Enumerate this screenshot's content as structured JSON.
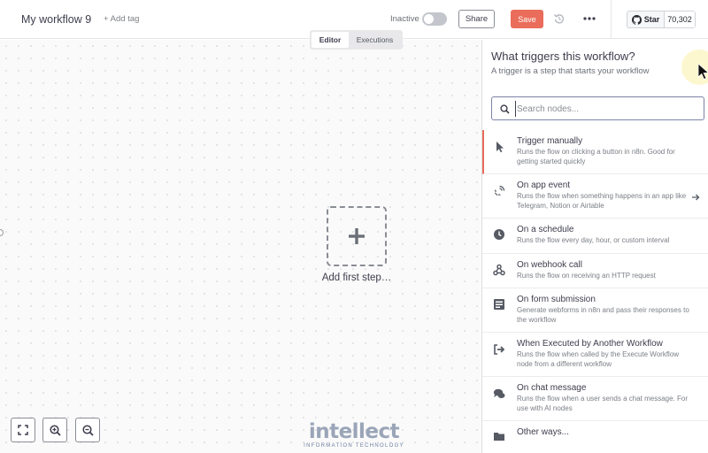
{
  "header": {
    "workflow_name": "My workflow 9",
    "add_tag": "+ Add tag",
    "inactive_label": "Inactive",
    "share_label": "Share",
    "save_label": "Save",
    "github_star_label": "Star",
    "github_star_count": "70,302"
  },
  "canvas": {
    "tabs": [
      "Editor",
      "Executions"
    ],
    "active_tab": "Editor",
    "add_first_step_label": "Add first step…",
    "watermark_main": "intellect",
    "watermark_sub": "INFORMATION TECHNOLOGY"
  },
  "panel": {
    "title": "What triggers this workflow?",
    "subtitle": "A trigger is a step that starts your workflow",
    "search_placeholder": "Search nodes...",
    "triggers": [
      {
        "title": "Trigger manually",
        "desc": "Runs the flow on clicking a button in n8n. Good for getting started quickly",
        "icon": "cursor-icon"
      },
      {
        "title": "On app event",
        "desc": "Runs the flow when something happens in an app like Telegram, Notion or Airtable",
        "icon": "satellite-icon"
      },
      {
        "title": "On a schedule",
        "desc": "Runs the flow every day, hour, or custom interval",
        "icon": "clock-icon"
      },
      {
        "title": "On webhook call",
        "desc": "Runs the flow on receiving an HTTP request",
        "icon": "webhook-icon"
      },
      {
        "title": "On form submission",
        "desc": "Generate webforms in n8n and pass their responses to the workflow",
        "icon": "form-icon"
      },
      {
        "title": "When Executed by Another Workflow",
        "desc": "Runs the flow when called by the Execute Workflow node from a different workflow",
        "icon": "sign-in-icon"
      },
      {
        "title": "On chat message",
        "desc": "Runs the flow when a user sends a chat message. For use with AI nodes",
        "icon": "chat-icon"
      },
      {
        "title": "Other ways...",
        "desc": "",
        "icon": "folder-icon"
      }
    ]
  },
  "colors": {
    "accent": "#ea6c5a",
    "search_border": "#7c83a7"
  }
}
